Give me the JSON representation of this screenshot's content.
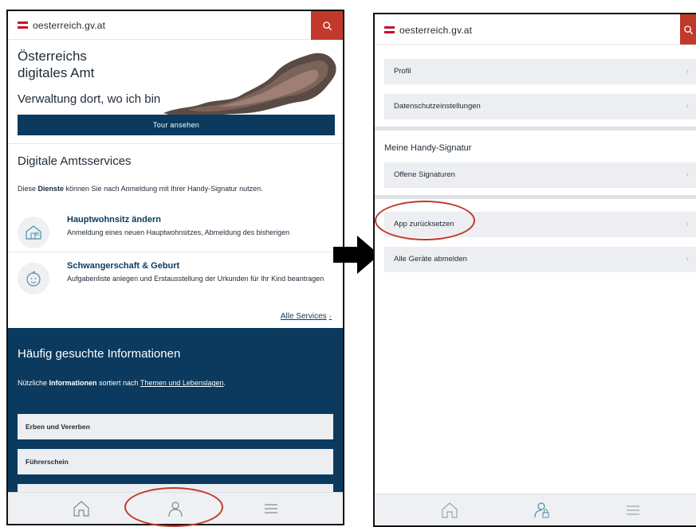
{
  "left": {
    "header": {
      "logo_text": "oesterreich.gv.at"
    },
    "hero": {
      "title": "Österreichs\ndigitales Amt",
      "subtitle": "Verwaltung dort, wo ich bin",
      "tour_button": "Tour ansehen"
    },
    "services": {
      "title": "Digitale Amtsservices",
      "desc_bold": "Dienste",
      "desc_pre": "Diese ",
      "desc_post": " können Sie nach Anmeldung mit Ihrer Handy-Signatur nutzen.",
      "items": [
        {
          "title": "Hauptwohnsitz ändern",
          "desc": "Anmeldung eines neuen Hauptwohnsitzes, Abmeldung des bisherigen",
          "icon": "house-icon"
        },
        {
          "title": "Schwangerschaft & Geburt",
          "desc": "Aufgabenliste anlegen und Erstausstellung der Urkunden für Ihr Kind beantragen",
          "icon": "baby-icon"
        }
      ],
      "all_link": "Alle Services",
      "all_chevron": "›"
    },
    "info": {
      "title": "Häufig gesuchte Informationen",
      "desc_pre": "Nützliche ",
      "desc_bold": "Informationen",
      "desc_mid": " sortiert nach ",
      "desc_link": "Themen und Lebenslagen",
      "desc_post": ".",
      "items": [
        "Erben und Vererben",
        "Führerschein",
        ""
      ]
    },
    "tabbar": {
      "tabs": [
        "home-icon",
        "profile-icon",
        "menu-icon"
      ]
    }
  },
  "right": {
    "header": {
      "logo_text": "oesterreich.gv.at"
    },
    "rows_top": [
      {
        "label": "Profil",
        "chevron": "›"
      },
      {
        "label": "Datenschutzeinstellungen",
        "chevron": "›"
      }
    ],
    "signatur_heading": "Meine Handy-Signatur",
    "rows_mid": [
      {
        "label": "Offene Signaturen",
        "chevron": "›"
      }
    ],
    "rows_bottom": [
      {
        "label": "App zurücksetzen",
        "chevron": "›"
      },
      {
        "label": "Alle Geräte abmelden",
        "chevron": "›"
      }
    ],
    "tabbar": {
      "tabs": [
        "home-icon",
        "profile-signature-icon",
        "menu-icon"
      ]
    }
  },
  "colors": {
    "brand_red": "#c8102e",
    "search_red": "#c0392b",
    "navy": "#0b3a5e",
    "annotation_red": "#c0392b"
  }
}
